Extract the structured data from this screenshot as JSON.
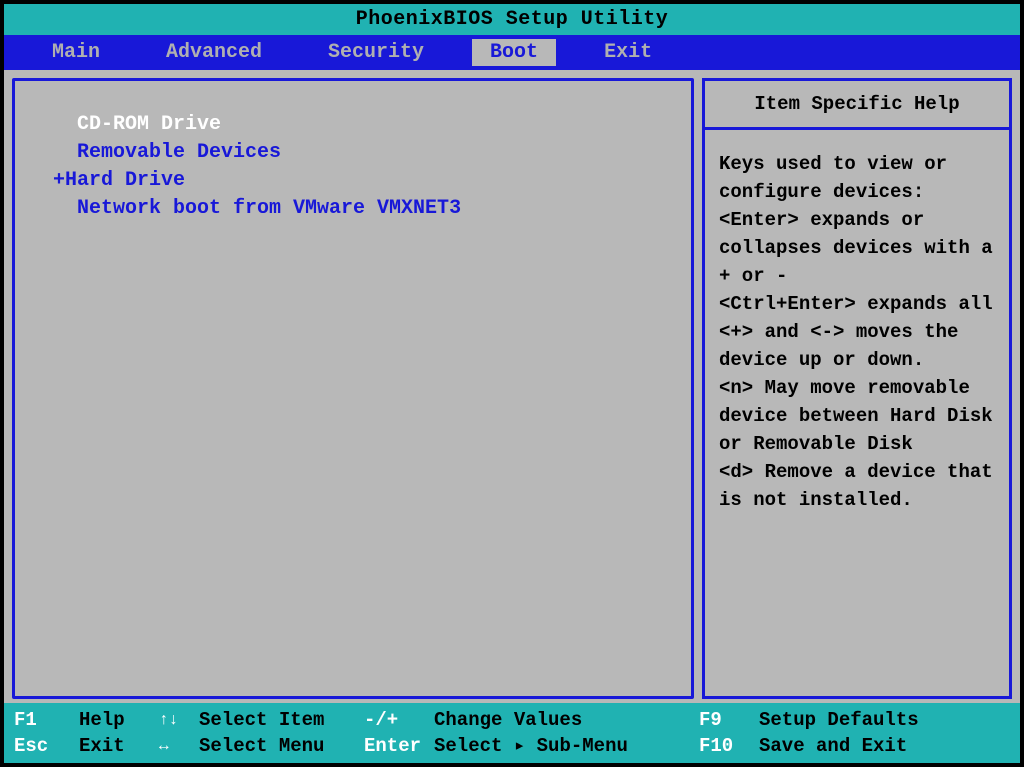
{
  "title": "PhoenixBIOS Setup Utility",
  "menu": {
    "items": [
      "Main",
      "Advanced",
      "Security",
      "Boot",
      "Exit"
    ],
    "active": "Boot"
  },
  "boot": {
    "items": [
      {
        "label": " CD-ROM Drive",
        "selected": true,
        "expandable": false
      },
      {
        "label": " Removable Devices",
        "selected": false,
        "expandable": false
      },
      {
        "label": "Hard Drive",
        "selected": false,
        "expandable": true
      },
      {
        "label": " Network boot from VMware VMXNET3",
        "selected": false,
        "expandable": false
      }
    ]
  },
  "help": {
    "header": "Item Specific Help",
    "body": "Keys used to view or configure devices:\n<Enter> expands or collapses devices with a + or -\n<Ctrl+Enter> expands all\n<+> and <-> moves the device up or down.\n<n> May move removable device between Hard Disk or Removable Disk\n<d> Remove a device that is not installed."
  },
  "footer": {
    "row1": {
      "k1": "F1",
      "l1": "Help",
      "k2": "↑↓",
      "l2": "Select Item",
      "k3": "-/+",
      "l3": "Change Values",
      "k4": "F9",
      "l4": "Setup Defaults"
    },
    "row2": {
      "k1": "Esc",
      "l1": "Exit",
      "k2": "↔",
      "l2": "Select Menu",
      "k3": "Enter",
      "l3": "Select ▸ Sub-Menu",
      "k4": "F10",
      "l4": "Save and Exit"
    }
  }
}
